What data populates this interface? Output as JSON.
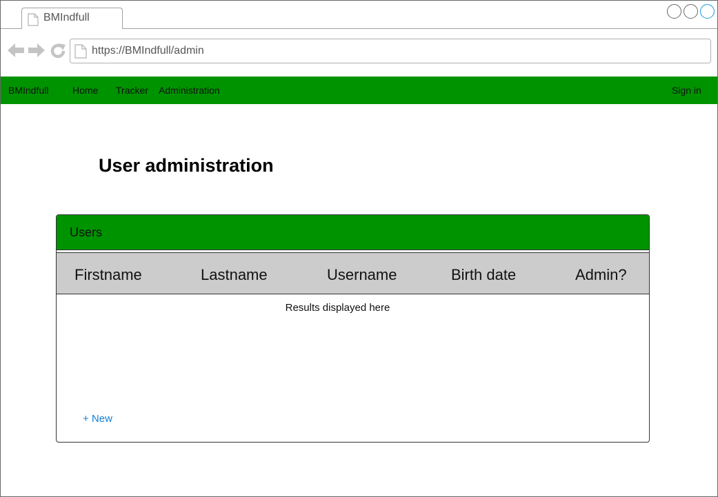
{
  "browser": {
    "tab_title": "BMIndfull",
    "url": "https://BMIndfull/admin"
  },
  "navbar": {
    "brand": "BMIndfull",
    "items": [
      {
        "label": "Home"
      },
      {
        "label": "Tracker"
      },
      {
        "label": "Administration"
      }
    ],
    "sign_in": "Sign in",
    "color": "#009300"
  },
  "page": {
    "title": "User administration"
  },
  "users_panel": {
    "title": "Users",
    "columns": [
      "Firstname",
      "Lastname",
      "Username",
      "Birth date",
      "Admin?"
    ],
    "results_placeholder": "Results displayed here",
    "new_link": "+ New",
    "header_color": "#009300",
    "table_header_color": "#cccccc",
    "link_color": "#0f7fd6"
  },
  "icons": {
    "tab": "page-icon",
    "back": "arrow-left-icon",
    "forward": "arrow-right-icon",
    "reload": "reload-icon",
    "url": "page-icon"
  }
}
